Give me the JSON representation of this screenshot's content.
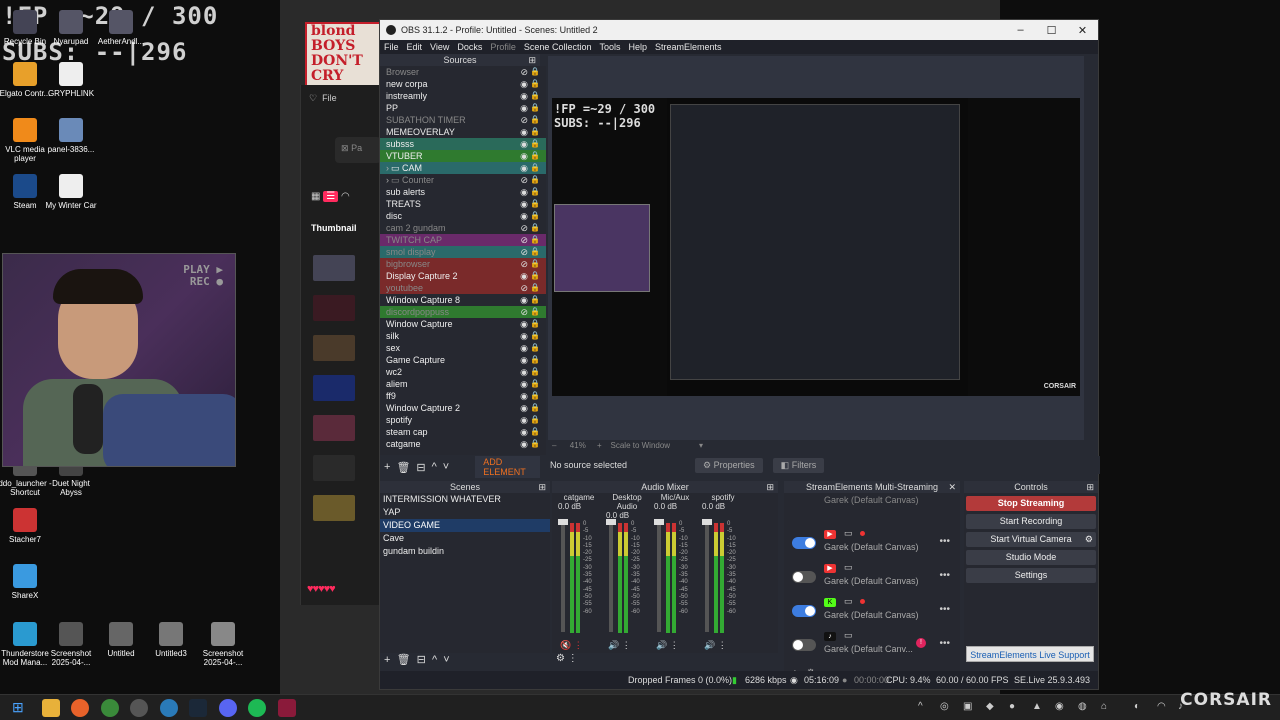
{
  "hud": {
    "line1": "!FP =~29 / 300",
    "line2": "SUBS: --|296"
  },
  "desktop_icons": [
    {
      "label": "Recycle Bin",
      "icon": "recycle-bin-icon"
    },
    {
      "label": "Nyarupad",
      "icon": "app-icon"
    },
    {
      "label": "AetherAndl...",
      "icon": "app-icon"
    },
    {
      "label": "Elgato Contr...",
      "icon": "elgato-icon"
    },
    {
      "label": "GRYPHLINK",
      "icon": "gryphlink-icon"
    },
    {
      "label": "VLC media player",
      "icon": "vlc-icon"
    },
    {
      "label": "panel-3836...",
      "icon": "image-file-icon"
    },
    {
      "label": "Steam",
      "icon": "steam-icon"
    },
    {
      "label": "My Winter Car",
      "icon": "game-icon"
    },
    {
      "label": "ddo_launcher - Shortcut",
      "icon": "shortcut-icon"
    },
    {
      "label": "Duet Night Abyss",
      "icon": "game-icon"
    },
    {
      "label": "Stacher7",
      "icon": "stacher-icon"
    },
    {
      "label": "ShareX",
      "icon": "sharex-icon"
    },
    {
      "label": "Thunderstore Mod Mana...",
      "icon": "thunderstore-icon"
    },
    {
      "label": "Screenshot 2025-04-...",
      "icon": "image-file-icon"
    },
    {
      "label": "Untitled",
      "icon": "image-file-icon"
    },
    {
      "label": "Untitled3",
      "icon": "image-file-icon"
    },
    {
      "label": "Screenshot 2025-04-...",
      "icon": "image-file-icon"
    }
  ],
  "webcam": {
    "overlay_line1": "PLAY ▶",
    "overlay_line2": "REC ●"
  },
  "poster": {
    "line1": "blond",
    "line2": "BOYS",
    "line3": "DON'T",
    "line4": "CRY"
  },
  "side_panel": {
    "file_label": "File",
    "tab_label": "Thumbnail",
    "hearts": "♥♥♥♥♥",
    "search_placeholder": "Pa"
  },
  "obs": {
    "title": "OBS 31.1.2 - Profile: Untitled - Scenes: Untitled 2",
    "menu": [
      "File",
      "Edit",
      "View",
      "Docks",
      "Profile",
      "Scene Collection",
      "Tools",
      "Help",
      "StreamElements"
    ],
    "sources_header": "Sources",
    "sources": [
      {
        "name": "Browser",
        "color": "",
        "dim": true
      },
      {
        "name": "new corpa",
        "color": "",
        "dim": false
      },
      {
        "name": "instreamly",
        "color": "",
        "dim": false
      },
      {
        "name": "PP",
        "color": "",
        "dim": false
      },
      {
        "name": "SUBATHON TIMER",
        "color": "",
        "dim": true
      },
      {
        "name": "MEMEOVERLAY",
        "color": "",
        "dim": false
      },
      {
        "name": "subsss",
        "color": "#2a6a5a",
        "dim": false
      },
      {
        "name": "VTUBER",
        "color": "#2f7a2f",
        "dim": false
      },
      {
        "name": "CAM",
        "color": "#2a6a6a",
        "dim": false,
        "group": true
      },
      {
        "name": "Counter",
        "color": "",
        "dim": true,
        "group": true
      },
      {
        "name": "sub alerts",
        "color": "",
        "dim": false
      },
      {
        "name": "TREATS",
        "color": "",
        "dim": false
      },
      {
        "name": "disc",
        "color": "",
        "dim": false
      },
      {
        "name": "cam 2 gundam",
        "color": "",
        "dim": true
      },
      {
        "name": "TWITCH CAP",
        "color": "#6a2a6a",
        "dim": true
      },
      {
        "name": "smol display",
        "color": "#2a6a6a",
        "dim": true
      },
      {
        "name": "bigbrowser",
        "color": "#7a2a2a",
        "dim": true
      },
      {
        "name": "Display Capture 2",
        "color": "#7a2a2a",
        "dim": false
      },
      {
        "name": "youtubee",
        "color": "#7a2a2a",
        "dim": true
      },
      {
        "name": "Window Capture 8",
        "color": "",
        "dim": false
      },
      {
        "name": "discordpoppuss",
        "color": "#2f7a2f",
        "dim": true
      },
      {
        "name": "Window Capture",
        "color": "",
        "dim": false
      },
      {
        "name": "silk",
        "color": "",
        "dim": false
      },
      {
        "name": "sex",
        "color": "",
        "dim": false
      },
      {
        "name": "Game Capture",
        "color": "",
        "dim": false
      },
      {
        "name": "wc2",
        "color": "",
        "dim": false
      },
      {
        "name": "aliem",
        "color": "",
        "dim": false
      },
      {
        "name": "ff9",
        "color": "",
        "dim": false
      },
      {
        "name": "Window Capture 2",
        "color": "",
        "dim": false
      },
      {
        "name": "spotify",
        "color": "",
        "dim": false
      },
      {
        "name": "steam cap",
        "color": "",
        "dim": false
      },
      {
        "name": "catgame",
        "color": "",
        "dim": false
      }
    ],
    "zoom": "41%",
    "scale_label": "Scale to Window",
    "add_element": "ADD ELEMENT",
    "no_source": "No source selected",
    "properties": "Properties",
    "filters": "Filters",
    "scenes_header": "Scenes",
    "scenes": [
      {
        "name": "INTERMISSION WHATEVER",
        "selected": false
      },
      {
        "name": "YAP",
        "selected": false
      },
      {
        "name": "VIDEO GAME",
        "selected": true
      },
      {
        "name": "Cave",
        "selected": false
      },
      {
        "name": "gundam buildin",
        "selected": false
      }
    ],
    "mixer_header": "Audio Mixer",
    "mixer": [
      {
        "name": "catgame",
        "db": "0.0 dB",
        "muted": true
      },
      {
        "name": "Desktop Audio",
        "db": "0.0 dB",
        "muted": false
      },
      {
        "name": "Mic/Aux",
        "db": "0.0 dB",
        "muted": false
      },
      {
        "name": "spotify",
        "db": "0.0 dB",
        "muted": false
      }
    ],
    "mixer_ticks": [
      "0",
      "-5",
      "-10",
      "-15",
      "-20",
      "-25",
      "-30",
      "-35",
      "-40",
      "-45",
      "-50",
      "-55",
      "-60"
    ],
    "multi_header": "StreamElements Multi-Streaming",
    "multi_rows": [
      {
        "label": "Garek (Default Canvas)",
        "on": true,
        "platform": "youtube",
        "live": true
      },
      {
        "label": "Garek (Default Canvas)",
        "on": false,
        "platform": "youtube",
        "live": false
      },
      {
        "label": "Garek (Default Canvas)",
        "on": true,
        "platform": "kick",
        "live": true
      },
      {
        "label": "Garek (Default Canv...",
        "on": false,
        "platform": "tiktok",
        "live": false,
        "warn": true
      }
    ],
    "multi_top_label": "Garek (Default Canvas)",
    "controls_header": "Controls",
    "controls": [
      "Stop Streaming",
      "Start Recording",
      "Start Virtual Camera",
      "Studio Mode",
      "Settings"
    ],
    "support": "StreamElements Live Support",
    "status": {
      "dropped": "Dropped Frames 0 (0.0%)",
      "kbps": "6286 kbps",
      "stream_time": "05:16:09",
      "rec_time": "00:00:00",
      "cpu": "CPU: 9.4%",
      "fps": "60.00 / 60.00 FPS",
      "version": "SE.Live 25.9.3.493"
    }
  },
  "watermark": "CORSAIR",
  "colors": {
    "accent": "#3d7de0",
    "stop": "#b33a3a",
    "live": "#e33333",
    "hearts": "#ff2b5e"
  }
}
